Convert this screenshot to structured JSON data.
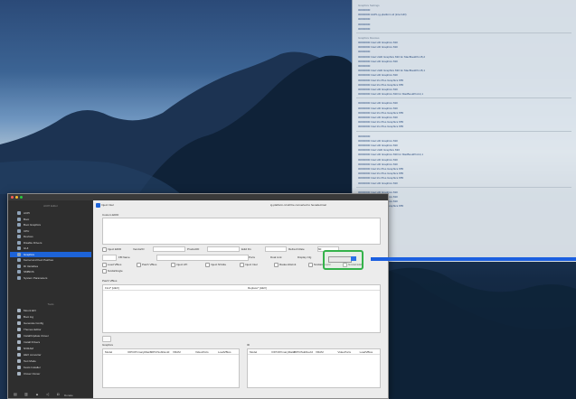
{
  "log": {
    "sec1_header": "Graphics Settings",
    "sec1_lines": [
      "00000000",
      "00000000 AAPL,ig-platform-id (intel HD)",
      "00000000",
      "00000000",
      "00000000"
    ],
    "sec2_header": "Graphics Devices",
    "sec2_lines": [
      "00000000 Intel HD Graphics 630",
      "00000000 Intel HD Graphics 630",
      "00000000",
      "00000000 Intel UHD Graphics 630 for MacBookPro15,2",
      "00000000 Intel HD Graphics 630",
      "00000000",
      "00000000 Intel UHD Graphics 630 for MacBookPro15,1",
      "00000000 Intel HD Graphics 630",
      "00000000 Intel Iris Plus Graphics 655",
      "00000000 Intel Iris Plus Graphics 655",
      "00000000 Intel HD Graphics 630",
      "00000000 Intel HD Graphics 630 for MacBookPro14,1"
    ],
    "sec3_header": "",
    "sec3_lines": [
      "00000000 Intel HD Graphics 630",
      "00000000 Intel HD Graphics 630",
      "00000000 Intel Iris Plus Graphics 655",
      "00000000 Intel HD Graphics 630",
      "00000000 Intel Iris Plus Graphics 655",
      "00000000 Intel Iris Plus Graphics 655"
    ],
    "sec4_header": "",
    "sec4_lines": [
      "00000000",
      "00000000 Intel HD Graphics 630",
      "00000000 Intel HD Graphics 630",
      "00000000 Intel UHD Graphics 630",
      "00000000 Intel HD Graphics 630 for MacBookPro14,1",
      "00000000 Intel HD Graphics 630",
      "00000000 Intel HD Graphics 630",
      "00000000 Intel Iris Plus Graphics 655",
      "00000000 Intel Iris Plus Graphics 655",
      "00000000 Intel Iris Plus Graphics 655",
      "00000000 Intel HD Graphics 630"
    ],
    "sec5_lines": [
      "00000000 Intel HD Graphics 630",
      "00000000 Intel HD Graphics 630",
      "00000000 Intel HD Graphics 630",
      "00000000 Intel Iris Plus Graphics 655"
    ]
  },
  "sidebar": {
    "header1": "ACPI Editor",
    "items": [
      "ACPI",
      "Boot",
      "Boot Graphics",
      "CPU",
      "Devices",
      "Disable Drivers",
      "GUI",
      "Graphics",
      "Kernel and Kext Patches",
      "Rt Variables",
      "SMBIOS",
      "System Parameters"
    ],
    "active_index": 7,
    "header2": "Tools",
    "tools": [
      "Mount EFI",
      "Boot log",
      "Generate Config",
      "Themes Editor",
      "Install/Update Clover",
      "Install Drivers",
      "NVRAM",
      "HEX converter",
      "Text Mode",
      "Kexts Installer",
      "Clover Cloner"
    ],
    "footer_label": "Donate"
  },
  "content": {
    "inject_label": "Inject Intel",
    "custom_edid_label": "Custom EDID",
    "row1": {
      "label1": "Inject EDID",
      "label2": "VendorID",
      "label3": "ProductID",
      "label4": "Edid Fix",
      "label5": "Refresh Rate",
      "value5": "60"
    },
    "row2": {
      "label1": "FB Name",
      "label2": "Ports",
      "label3": "Dual Link",
      "label4": "Display Cfg"
    },
    "checkbox_row": [
      "Load VBios",
      "Patch VBios",
      "Inject ATI",
      "Inject NVidia",
      "Inject Intel",
      "RadeonDeInit",
      "NvidiaGeneric",
      "NvidiaNoEFI"
    ],
    "extra_checkbox": "NvidiaSingle",
    "table1": {
      "title": "Patch VBios",
      "col1": "Find* [HEX]",
      "col2": "Replace* [HEX]"
    },
    "table2": {
      "title": "Graphics",
      "cols": [
        "Model",
        "IOPCIPrimaryMatch",
        "IOPCISubDevId",
        "VRAM",
        "VideoPorts",
        "LoadVBios"
      ]
    },
    "table3": {
      "title": "ID",
      "cols": [
        "Model",
        "IOPCIPrimaryMatch",
        "IOPCISubDevId",
        "VRAM",
        "VideoPorts",
        "LoadVBios"
      ]
    },
    "header_note": "ig-platform-id will be converted to hexadecimal"
  },
  "colors": {
    "accent": "#1d63d8",
    "green_highlight": "#34b24a"
  }
}
